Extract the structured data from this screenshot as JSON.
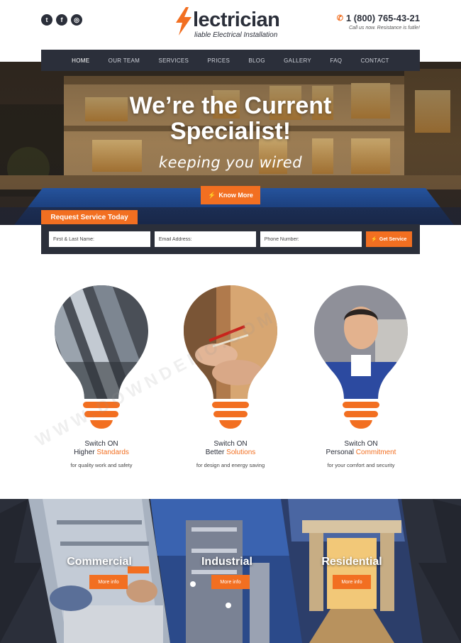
{
  "header": {
    "social_icons": [
      "twitter-icon",
      "facebook-icon",
      "instagram-icon"
    ],
    "social_glyphs": [
      "t",
      "f",
      "◎"
    ],
    "logo_title": "lectrician",
    "logo_tagline": "liable Electrical Installation",
    "phone": "1 (800) 765-43-21",
    "phone_tagline": "Call us now. Resistance is futile!"
  },
  "nav": {
    "items": [
      "HOME",
      "OUR TEAM",
      "SERVICES",
      "PRICES",
      "BLOG",
      "GALLERY",
      "FAQ",
      "CONTACT"
    ],
    "active": "HOME"
  },
  "hero": {
    "title_line1": "We’re the Current",
    "title_line2": "Specialist!",
    "subtitle": "keeping you wired",
    "button_label": "Know More"
  },
  "request": {
    "tab_label": "Request Service Today",
    "name_placeholder": "First & Last Name:",
    "email_placeholder": "Email Address:",
    "phone_placeholder": "Phone Number:",
    "button_label": "Get Service"
  },
  "features": [
    {
      "line1": "Switch ON",
      "line2_plain": "Higher ",
      "line2_highlight": "Standards",
      "desc": "for quality work and safety"
    },
    {
      "line1": "Switch ON",
      "line2_plain": "Better ",
      "line2_highlight": "Solutions",
      "desc": "for design and energy saving"
    },
    {
      "line1": "Switch ON",
      "line2_plain": "Personal ",
      "line2_highlight": "Commitment",
      "desc": "for your comfort and security"
    }
  ],
  "services": [
    {
      "label": "Commercial",
      "button": "More info"
    },
    {
      "label": "Industrial",
      "button": "More info"
    },
    {
      "label": "Residential",
      "button": "More info"
    }
  ],
  "watermark": "WWW.DOWNDEMO.COM",
  "colors": {
    "accent": "#f26f21",
    "dark": "#2b2f3a"
  }
}
